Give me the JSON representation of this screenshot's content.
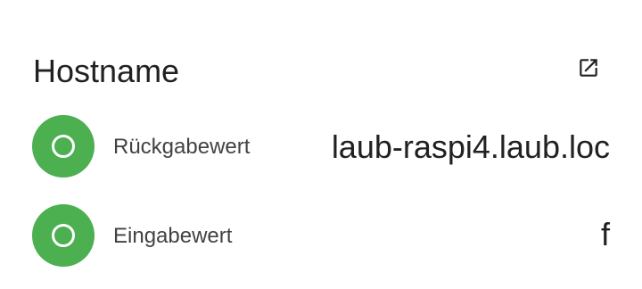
{
  "card": {
    "title": "Hostname",
    "open_icon": "open-in-new-icon"
  },
  "rows": [
    {
      "icon": "circle-outline-icon",
      "label": "Rückgabewert",
      "value": "laub-raspi4.laub.loc",
      "badge_color": "#4caf50"
    },
    {
      "icon": "circle-outline-icon",
      "label": "Eingabewert",
      "value": "f",
      "badge_color": "#4caf50"
    }
  ]
}
